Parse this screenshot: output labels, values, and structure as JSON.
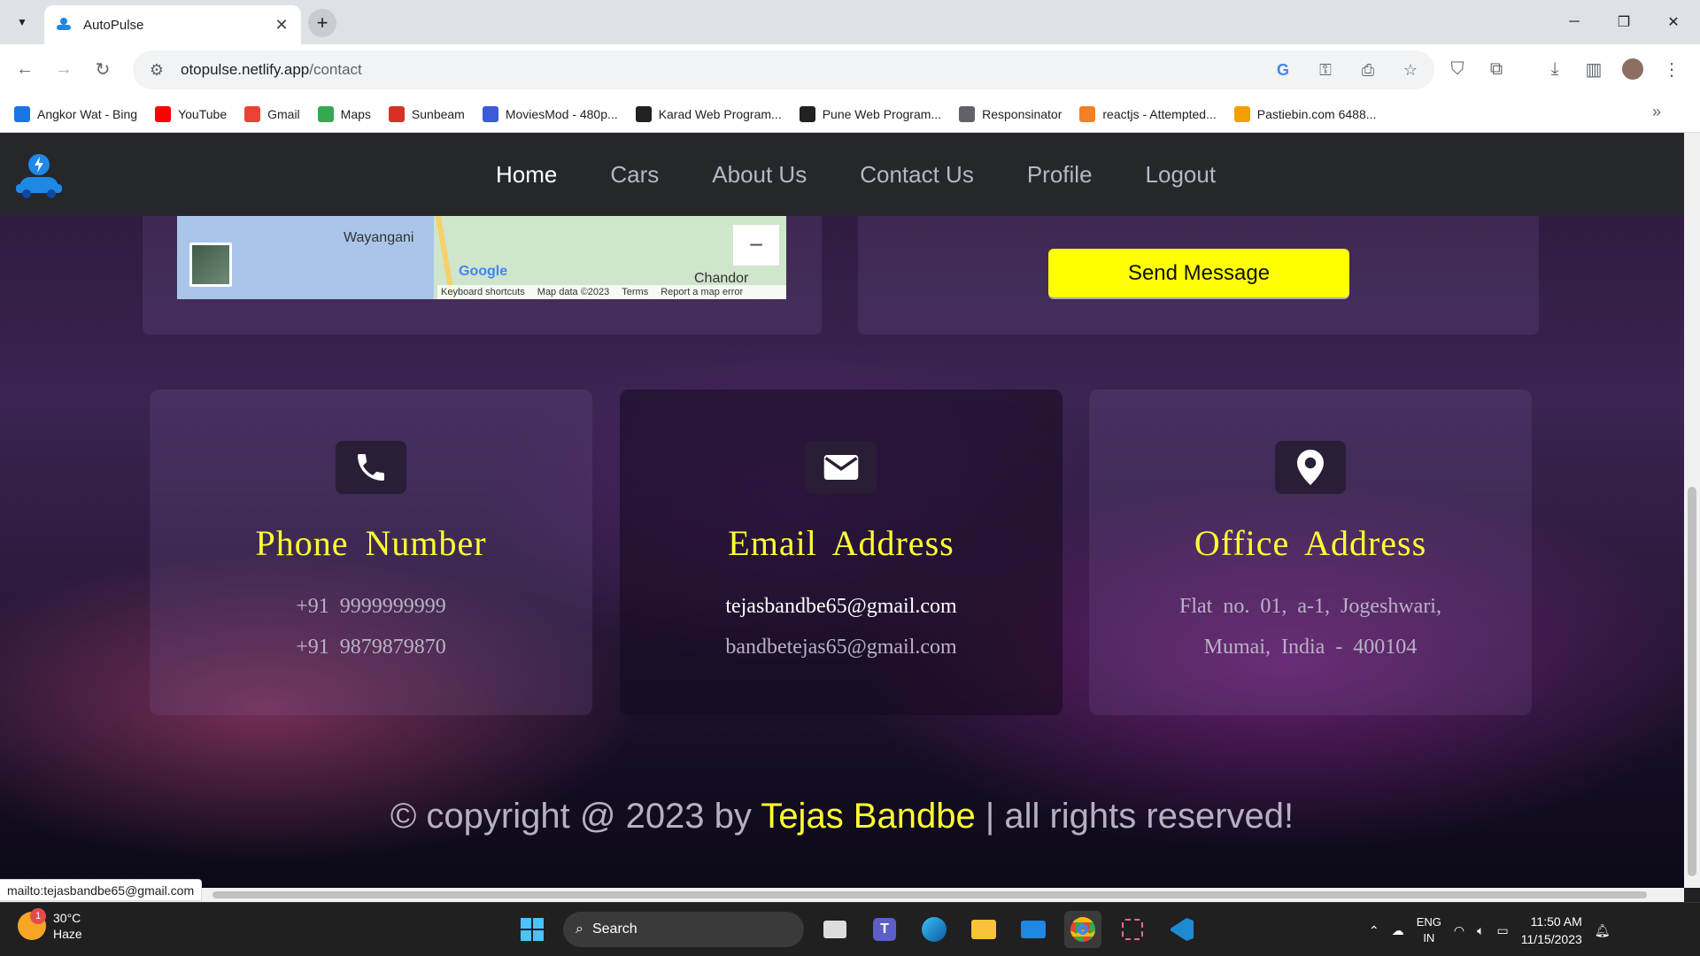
{
  "browser": {
    "tab_title": "AutoPulse",
    "url_domain": "otopulse.netlify.app",
    "url_path": "/contact",
    "bookmarks": [
      {
        "label": "Angkor Wat - Bing",
        "icon": "bing-search-icon",
        "color": "#1a73e8"
      },
      {
        "label": "YouTube",
        "icon": "youtube-icon",
        "color": "#ff0000"
      },
      {
        "label": "Gmail",
        "icon": "gmail-icon",
        "color": "#ea4335"
      },
      {
        "label": "Maps",
        "icon": "maps-pin-icon",
        "color": "#34a853"
      },
      {
        "label": "Sunbeam",
        "icon": "sunbeam-icon",
        "color": "#d93025"
      },
      {
        "label": "MoviesMod - 480p...",
        "icon": "moviesmod-icon",
        "color": "#3b5bdb"
      },
      {
        "label": "Karad Web Program...",
        "icon": "globe-icon",
        "color": "#202124"
      },
      {
        "label": "Pune Web Program...",
        "icon": "globe-icon",
        "color": "#202124"
      },
      {
        "label": "Responsinator",
        "icon": "responsinator-icon",
        "color": "#5f6368"
      },
      {
        "label": "reactjs - Attempted...",
        "icon": "stackoverflow-icon",
        "color": "#f48024"
      },
      {
        "label": "Pastiebin.com 6488...",
        "icon": "pastiebin-icon",
        "color": "#f59f00"
      }
    ]
  },
  "site": {
    "nav": [
      "Home",
      "Cars",
      "About Us",
      "Contact Us",
      "Profile",
      "Logout"
    ],
    "active_nav": "Home",
    "map": {
      "place1": "Wayangani",
      "place2": "Chandor",
      "google": "Google",
      "attribution": [
        "Keyboard shortcuts",
        "Map data ©2023",
        "Terms",
        "Report a map error"
      ],
      "zoom_out": "−"
    },
    "send_button": "Send Message",
    "cards": [
      {
        "title": "Phone  Number",
        "icon": "phone-icon",
        "lines": [
          "+91  9999999999",
          "+91  9879879870"
        ]
      },
      {
        "title": "Email  Address",
        "icon": "envelope-icon",
        "lines": [
          "tejasbandbe65@gmail.com",
          "bandbetejas65@gmail.com"
        ]
      },
      {
        "title": "Office  Address",
        "icon": "location-pin-icon",
        "lines": [
          "Flat  no.  01,  a-1,  Jogeshwari,",
          "Mumai,  India  -  400104"
        ]
      }
    ],
    "footer": {
      "prefix": "© copyright @ 2023 by ",
      "name": "Tejas Bandbe",
      "suffix": " | all rights reserved!"
    },
    "status_url": "mailto:tejasbandbe65@gmail.com",
    "accent_color": "#ffff00"
  },
  "taskbar": {
    "weather_temp": "30°C",
    "weather_desc": "Haze",
    "weather_badge": "1",
    "search_label": "Search",
    "lang_top": "ENG",
    "lang_bottom": "IN",
    "time": "11:50 AM",
    "date": "11/15/2023"
  }
}
